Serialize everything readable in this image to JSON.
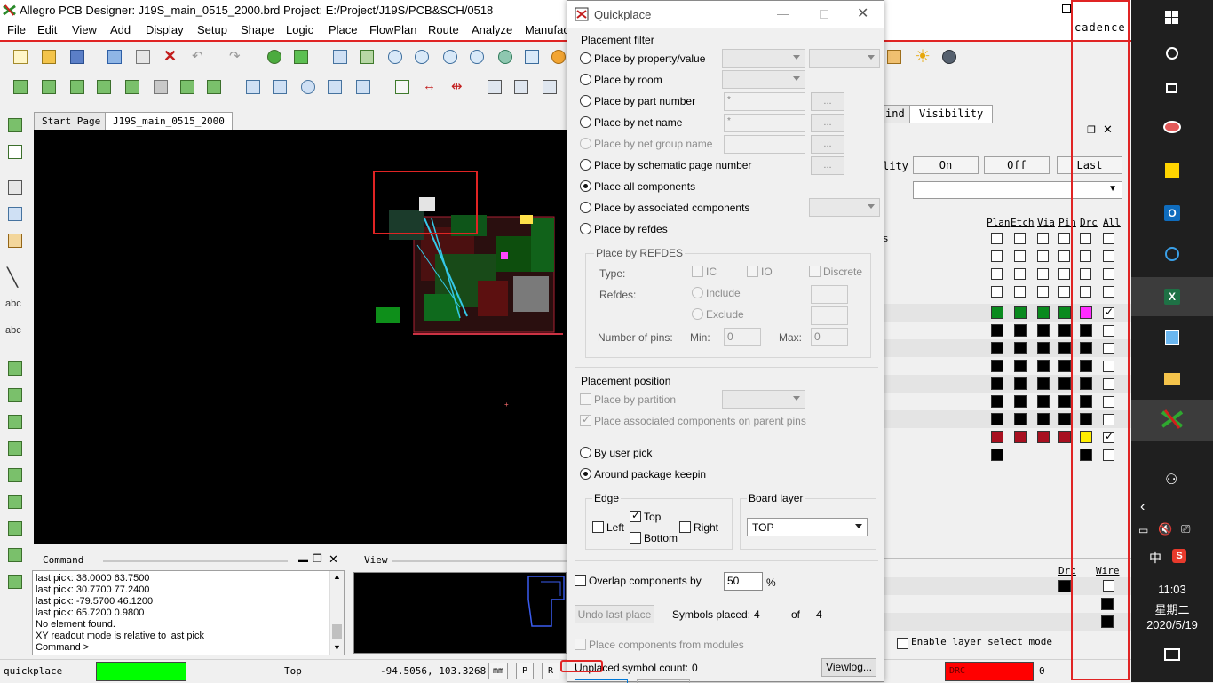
{
  "app": {
    "title": "Allegro PCB Designer: J19S_main_0515_2000.brd  Project: E:/Project/J19S/PCB&SCH/0518",
    "menu": [
      "File",
      "Edit",
      "View",
      "Add",
      "Display",
      "Setup",
      "Shape",
      "Logic",
      "Place",
      "FlowPlan",
      "Route",
      "Analyze",
      "Manufac"
    ],
    "brand": "cadence",
    "tabs": [
      "Start Page",
      "J19S_main_0515_2000"
    ]
  },
  "command": {
    "header": "Command",
    "lines": [
      "last pick:  38.0000 63.7500",
      "last pick:  30.7700 77.2400",
      "last pick:  -79.5700 46.1200",
      "last pick:  65.7200 0.9800",
      "No element found.",
      "XY readout mode is relative to last pick",
      "Command >"
    ]
  },
  "view_panel": {
    "header": "View"
  },
  "status": {
    "command_name": "quickplace",
    "layer": "Top",
    "coords": "-94.5056, 103.3268",
    "units": "mm",
    "btn_p": "P",
    "btn_r": "R",
    "drc_label": "DRC",
    "drc_count": "0",
    "colors": {
      "idle": "#00ff00",
      "drc": "#ff0000"
    }
  },
  "visibility": {
    "tab_partial": "ind",
    "tab_active": "Visibility",
    "label_partial": "lity",
    "btn_on": "On",
    "btn_off": "Off",
    "btn_last": "Last",
    "cols": [
      "Plan",
      "Etch",
      "Via",
      "Pin",
      "Drc",
      "All"
    ],
    "partial_text": "s",
    "bottom_cols": [
      "Drc",
      "Wire"
    ],
    "enable_layer_select": "Enable layer select mode"
  },
  "quickplace": {
    "title": "Quickplace",
    "filter_group": "Placement filter",
    "options": [
      {
        "label": "Place by property/value",
        "selected": false,
        "enabled": true
      },
      {
        "label": "Place by room",
        "selected": false,
        "enabled": true
      },
      {
        "label": "Place by part number",
        "selected": false,
        "enabled": true
      },
      {
        "label": "Place by net name",
        "selected": false,
        "enabled": true
      },
      {
        "label": "Place by net group name",
        "selected": false,
        "enabled": false
      },
      {
        "label": "Place by schematic page number",
        "selected": false,
        "enabled": true
      },
      {
        "label": "Place all components",
        "selected": true,
        "enabled": true
      },
      {
        "label": "Place by associated components",
        "selected": false,
        "enabled": true
      },
      {
        "label": "Place by refdes",
        "selected": false,
        "enabled": true
      }
    ],
    "part_number_value": "*",
    "net_name_value": "*",
    "browse_label": "...",
    "refdes_group": "Place by REFDES",
    "type_label": "Type:",
    "type_ic": "IC",
    "type_io": "IO",
    "type_discrete": "Discrete",
    "refdes_label": "Refdes:",
    "include_label": "Include",
    "exclude_label": "Exclude",
    "num_pins_label": "Number of pins:",
    "min_label": "Min:",
    "min_value": "0",
    "max_label": "Max:",
    "max_value": "0",
    "position_group": "Placement position",
    "by_partition": "Place by partition",
    "assoc_parent": "Place associated components on parent pins",
    "by_user_pick": "By user pick",
    "around_keepin": "Around package keepin",
    "around_keepin_selected": true,
    "edge_group": "Edge",
    "edge_left": "Left",
    "edge_top": "Top",
    "edge_right": "Right",
    "edge_bottom": "Bottom",
    "edge_top_checked": true,
    "board_layer_group": "Board layer",
    "board_layer_value": "TOP",
    "overlap_label": "Overlap components by",
    "overlap_value": "50",
    "overlap_unit": "%",
    "undo_label": "Undo last place",
    "symbols_placed_label": "Symbols placed:",
    "symbols_placed": "4",
    "of_label": "of",
    "symbols_total": "4",
    "from_modules": "Place components from modules",
    "unplaced_label": "Unplaced symbol count:",
    "unplaced_count": "0",
    "viewlog_label": "Viewlog..."
  },
  "taskbar": {
    "time": "11:03",
    "weekday": "星期二",
    "date": "2020/5/19",
    "ime": "中",
    "ime_logo": "S"
  }
}
